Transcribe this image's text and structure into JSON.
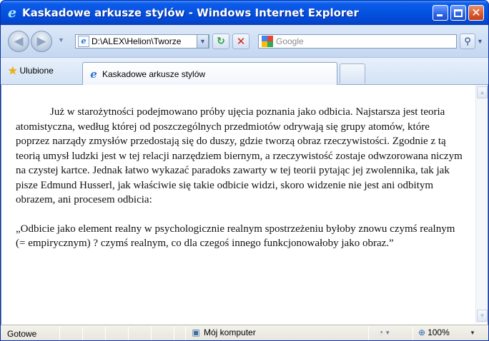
{
  "window": {
    "title": "Kaskadowe arkusze stylów - Windows Internet Explorer",
    "title_icon": "ie-logo-icon"
  },
  "navbar": {
    "back_icon": "back-arrow-icon",
    "forward_icon": "forward-arrow-icon",
    "address": "D:\\ALEX\\Helion\\Tworze",
    "search_placeholder": "Google",
    "refresh_glyph": "↻",
    "stop_glyph": "✕"
  },
  "tabs": {
    "favorites_label": "Ulubione",
    "active_tab": "Kaskadowe arkusze stylów"
  },
  "content": {
    "paragraph1": "Już w starożytności podejmowano próby ujęcia poznania jako odbicia. Najstarsza jest teoria atomistyczna, według której od poszczególnych przedmiotów odrywają się grupy atomów, które poprzez narządy zmysłów przedostają się do duszy, gdzie tworzą obraz rzeczywistości. Zgodnie z tą teorią umysł ludzki jest w tej relacji narzędziem biernym, a rzeczywistość zostaje odwzorowana niczym na czystej kartce. Jednak łatwo wykazać paradoks zawarty w tej teorii pytając jej zwolennika, tak jak pisze Edmund Husserl, jak właściwie się takie odbicie widzi, skoro widzenie nie jest ani odbitym obrazem, ani procesem odbicia:",
    "paragraph2": "„Odbicie jako element realny w psychologicznie realnym spostrzeżeniu byłoby znowu czymś realnym (= empirycznym) ? czymś realnym, co dla czegoś innego funkcjonowałoby jako obraz.”"
  },
  "statusbar": {
    "status": "Gotowe",
    "zone": "Mój komputer",
    "zoom": "100%"
  },
  "colors": {
    "titlebar": "#0553e1",
    "close_button": "#d9562c",
    "chrome": "#d3e2f5"
  }
}
